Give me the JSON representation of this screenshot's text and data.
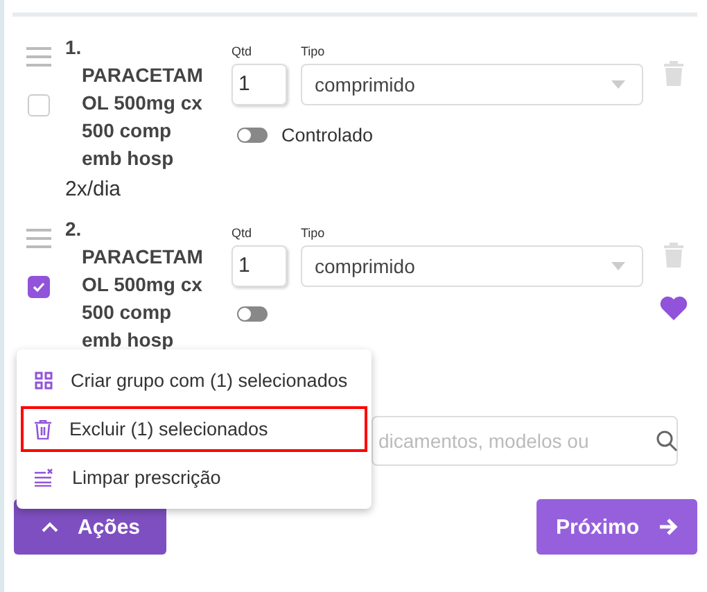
{
  "items": [
    {
      "name": "1. PARACETAMOL 500mg cx 500 comp emb hosp",
      "checked": false,
      "favorite": false,
      "qty_label": "Qtd",
      "qty": "1",
      "type_label": "Tipo",
      "type": "comprimido",
      "frequency": "2x/dia",
      "controlled": false,
      "controlled_label": "Controlado"
    },
    {
      "name": "2. PARACETAMOL 500mg cx 500 comp emb hosp",
      "checked": true,
      "favorite": true,
      "qty_label": "Qtd",
      "qty": "1",
      "type_label": "Tipo",
      "type": "comprimido",
      "controlled": false
    }
  ],
  "search": {
    "placeholder": "dicamentos, modelos ou"
  },
  "menu": [
    {
      "kind": "group",
      "label": "Criar grupo com (1) selecionados",
      "highlighted": false
    },
    {
      "kind": "delete",
      "label": "Excluir (1) selecionados",
      "highlighted": true
    },
    {
      "kind": "clear",
      "label": "Limpar prescrição",
      "highlighted": false
    }
  ],
  "actions_button": "Ações",
  "next_button": "Próximo"
}
